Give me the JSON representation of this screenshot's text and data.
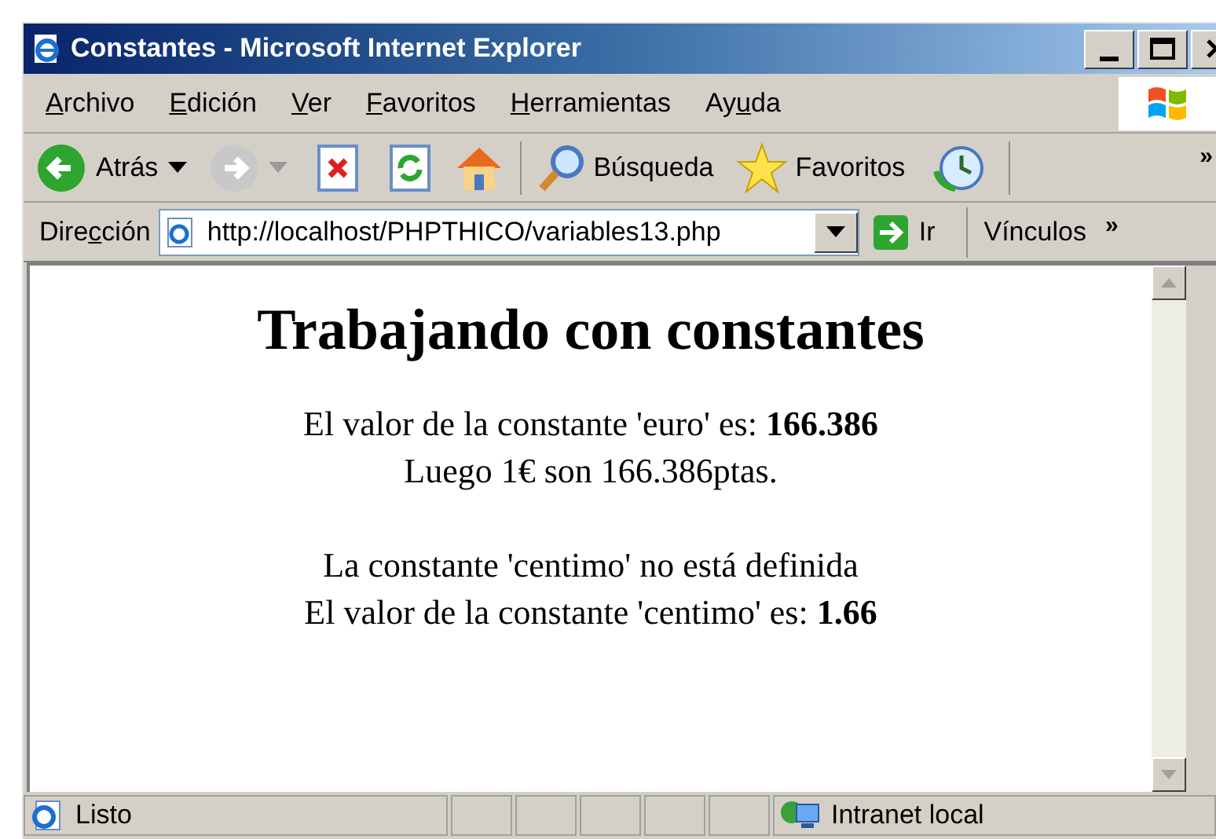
{
  "window": {
    "title": "Constantes - Microsoft Internet Explorer"
  },
  "menu": [
    {
      "key": "A",
      "post": "rchivo"
    },
    {
      "key": "E",
      "post": "dición"
    },
    {
      "key": "V",
      "post": "er"
    },
    {
      "key": "F",
      "post": "avoritos"
    },
    {
      "key": "H",
      "post": "erramientas"
    },
    {
      "pre": "Ay",
      "key": "u",
      "post": "da"
    }
  ],
  "toolbar": {
    "back": "Atrás",
    "search": "Búsqueda",
    "favorites": "Favoritos",
    "overflow": "»"
  },
  "address_bar": {
    "label": {
      "pre": "Dire",
      "key": "c",
      "post": "ción"
    },
    "value": "http://localhost/PHPTHICO/variables13.php",
    "go": "Ir",
    "links": "Vínculos",
    "overflow": "»"
  },
  "page": {
    "heading": "Trabajando con constantes",
    "paragraphs": [
      [
        "El valor de la constante 'euro' es: **166.386**",
        "Luego 1€ son 166.386ptas."
      ],
      [
        "La constante 'centimo' no está definida",
        "El valor de la constante 'centimo' es: **1.66**"
      ]
    ]
  },
  "status_bar": {
    "text": "Listo",
    "zone": "Intranet local"
  }
}
